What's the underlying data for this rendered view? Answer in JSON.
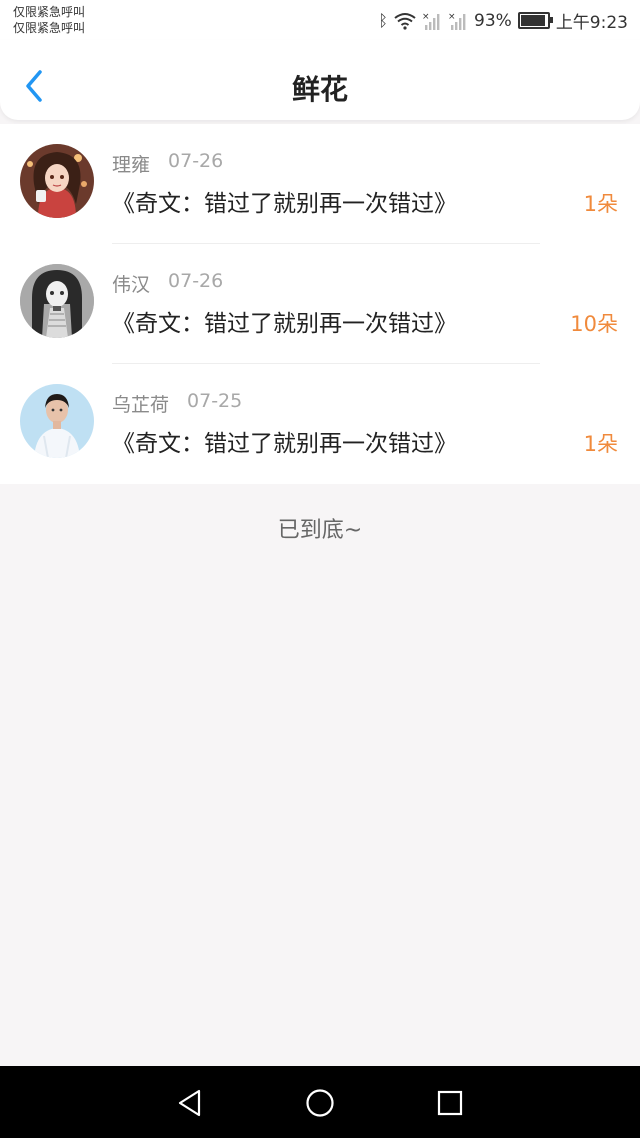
{
  "status_bar": {
    "carrier_line1": "仅限紧急呼叫",
    "carrier_line2": "仅限紧急呼叫",
    "battery_percent": "93%",
    "time": "上午9:23",
    "battery_level": 0.93
  },
  "header": {
    "title": "鲜花",
    "back_icon": "chevron-left-icon"
  },
  "flowers": [
    {
      "name": "理雍",
      "date": "07-26",
      "title": "《奇文：错过了就别再一次错过》",
      "count": "1朵"
    },
    {
      "name": "伟汉",
      "date": "07-26",
      "title": "《奇文：错过了就别再一次错过》",
      "count": "10朵"
    },
    {
      "name": "乌芷荷",
      "date": "07-25",
      "title": "《奇文：错过了就别再一次错过》",
      "count": "1朵"
    }
  ],
  "footer_text": "已到底~",
  "colors": {
    "accent": "#2196f3",
    "count": "#f08a3c",
    "background": "#f7f5f6"
  },
  "system_nav": {
    "back": "back-triangle-icon",
    "home": "home-circle-icon",
    "recent": "recent-square-icon"
  }
}
